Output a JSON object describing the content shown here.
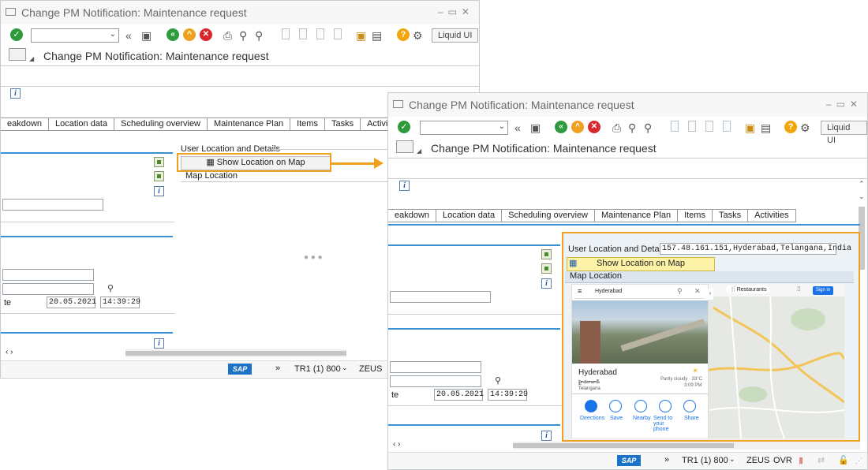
{
  "window": {
    "title": "Change PM Notification: Maintenance request",
    "screen_title": "Change PM Notification: Maintenance request",
    "liquid_ui": "Liquid UI"
  },
  "tabs": [
    "eakdown",
    "Location data",
    "Scheduling overview",
    "Maintenance Plan",
    "Items",
    "Tasks",
    "Activities"
  ],
  "back": {
    "tabs": [
      "eakdown",
      "Location data",
      "Scheduling overview",
      "Maintenance Plan",
      "Items",
      "Tasks",
      "Activitie"
    ],
    "user_location_label": "User Location and Details",
    "show_location_button": "Show Location on Map",
    "map_location_label": "Map Location",
    "date_prefix": "te",
    "date": "20.05.2021",
    "time": "14:39:29",
    "status": {
      "system": "TR1 (1) 800",
      "server": "ZEUS"
    }
  },
  "front": {
    "user_location_label": "User Location and Details",
    "user_location_value": "157.48.161.151,Hyderabad,Telangana,India",
    "show_location_button": "Show Location on Map",
    "map_location_label": "Map Location",
    "date_prefix": "te",
    "date": "20.05.2021",
    "time": "14:39:29",
    "status": {
      "system": "TR1 (1) 800",
      "server": "ZEUS",
      "mode": "OVR"
    }
  },
  "map": {
    "search_text": "Hyderabad",
    "restaurants": "Restaurants",
    "sign_in": "Sign in",
    "place_name": "Hyderabad",
    "place_native": "హైదరాబాద్",
    "place_region": "Telangana",
    "weather": "Partly cloudy · 33°C",
    "weather_time": "3:09 PM",
    "actions": [
      "Directions",
      "Save",
      "Nearby",
      "Send to your phone",
      "Share"
    ]
  },
  "colors": {
    "highlight": "#f0a020",
    "accent_blue": "#3d8fd3"
  }
}
